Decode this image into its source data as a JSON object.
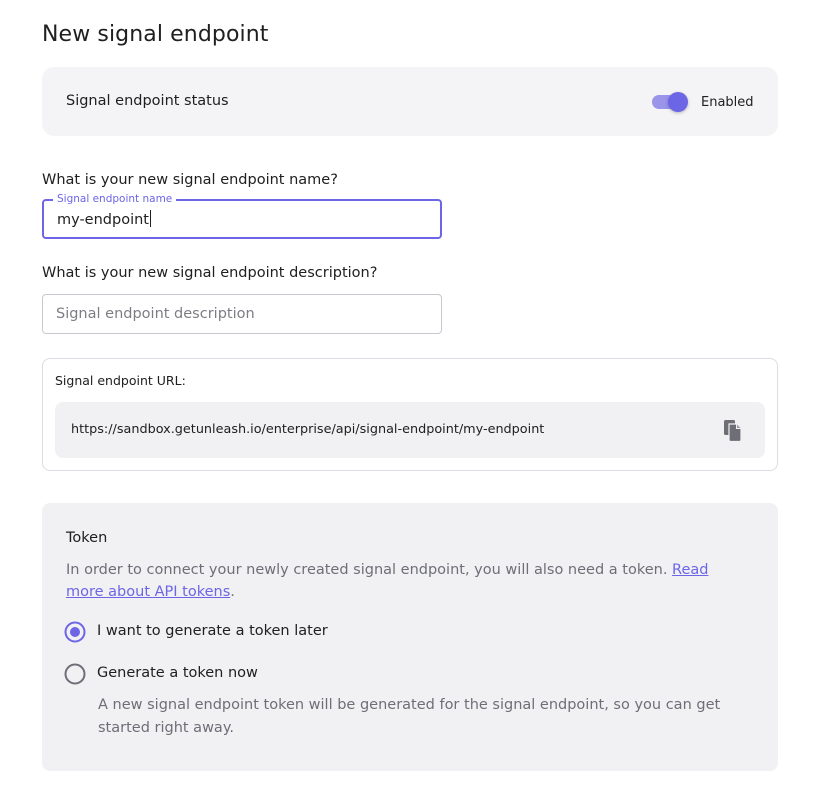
{
  "page": {
    "title": "New signal endpoint"
  },
  "status": {
    "label": "Signal endpoint status",
    "toggle_text": "Enabled",
    "enabled": true
  },
  "name_field": {
    "question": "What is your new signal endpoint name?",
    "legend": "Signal endpoint name",
    "value": "my-endpoint"
  },
  "description_field": {
    "question": "What is your new signal endpoint description?",
    "placeholder": "Signal endpoint description",
    "value": ""
  },
  "url": {
    "label": "Signal endpoint URL:",
    "value": "https://sandbox.getunleash.io/enterprise/api/signal-endpoint/my-endpoint",
    "copy_icon": "copy-icon"
  },
  "token": {
    "title": "Token",
    "description": "In order to connect your newly created signal endpoint, you will also need a token.",
    "link_text": "Read more about API tokens",
    "description_end": ".",
    "options": [
      {
        "label": "I want to generate a token later",
        "selected": true
      },
      {
        "label": "Generate a token now",
        "selected": false
      }
    ],
    "option_help": "A new signal endpoint token will be generated for the signal endpoint, so you can get started right away."
  },
  "colors": {
    "accent": "#6c65e5",
    "card_bg": "#f1f1f4",
    "muted_text": "#6e6e76"
  }
}
